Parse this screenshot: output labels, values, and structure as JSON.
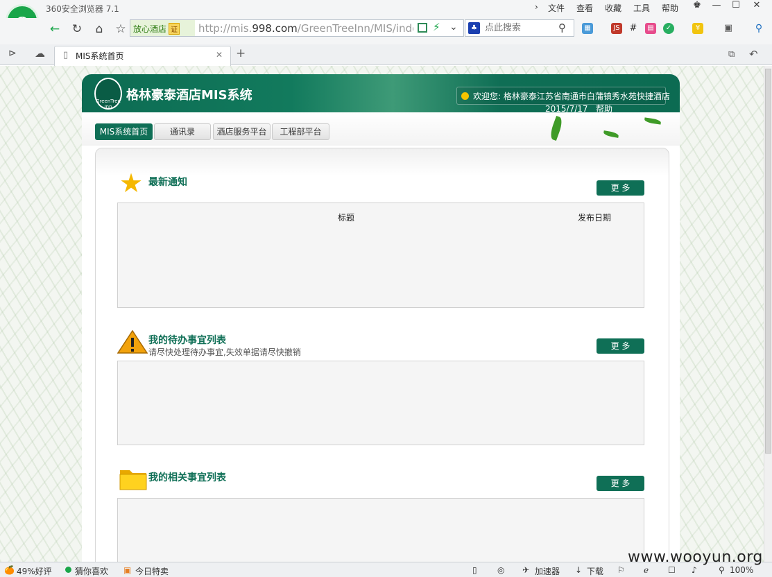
{
  "browser": {
    "title": "360安全浏览器 7.1",
    "menu": [
      "文件",
      "查看",
      "收藏",
      "工具",
      "帮助"
    ],
    "trust_badge": "放心酒店",
    "trust_tag": "证",
    "url_host_prefix": "http://mis.",
    "url_host": "998.com",
    "url_path": "/GreenTreeInn/MIS/inde",
    "search_placeholder": "点此搜索",
    "tab_title": "MIS系统首页"
  },
  "page": {
    "brand_logo_text": "GreenTree Inn",
    "brand_title": "格林豪泰酒店MIS系统",
    "welcome": "欢迎您:  格林豪泰江苏省南通市白蒲镇秀水苑快捷酒店",
    "date": "2015/7/17",
    "help": "帮助",
    "nav": [
      "MIS系统首页",
      "通讯录",
      "酒店服务平台",
      "工程部平台"
    ],
    "sections": {
      "notice": {
        "title": "最新通知",
        "more": "更 多",
        "col_title": "标题",
        "col_date": "发布日期"
      },
      "todo": {
        "title": "我的待办事宜列表",
        "subtitle": "请尽快处理待办事宜,失效单据请尽快撤销",
        "more": "更 多"
      },
      "related": {
        "title": "我的相关事宜列表",
        "more": "更 多"
      }
    }
  },
  "status": {
    "rating": "49%好评",
    "guess": "猜你喜欢",
    "deals": "今日特卖",
    "accelerator": "加速器",
    "download": "下载",
    "zoom": "100%"
  },
  "watermark": "www.wooyun.org",
  "colors": {
    "brand_green": "#0f6f56",
    "browser_green": "#1aa64a"
  }
}
